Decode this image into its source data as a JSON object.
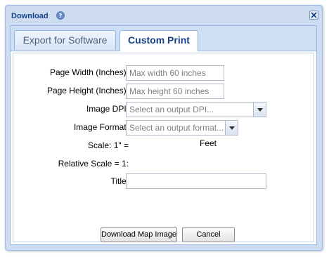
{
  "window": {
    "title": "Download"
  },
  "tabs": [
    {
      "label": "Export for Software",
      "active": false
    },
    {
      "label": "Custom Print",
      "active": true
    }
  ],
  "form": {
    "page_width_label": "Page Width (Inches):",
    "page_width_placeholder": "Max width 60 inches",
    "page_height_label": "Page Height (Inches):",
    "page_height_placeholder": "Max height 60 inches",
    "image_dpi_label": "Image DPI:",
    "image_dpi_value": "Select an output DPI...",
    "image_format_label": "Image Format:",
    "image_format_value": "Select an output format...",
    "scale_label": "Scale: 1\" =",
    "scale_unit": "Feet",
    "relative_scale_label": "Relative Scale = 1:",
    "title_label": "Title:",
    "title_value": ""
  },
  "buttons": {
    "download_label": "Download Map Image",
    "cancel_label": "Cancel"
  },
  "colors": {
    "title_text": "#15428b",
    "window_frame": "#cddcf0",
    "panel_border": "#99bbe8",
    "placeholder_text": "#808080"
  },
  "icons": [
    "help-icon",
    "close-icon",
    "dropdown-arrow-icon"
  ]
}
